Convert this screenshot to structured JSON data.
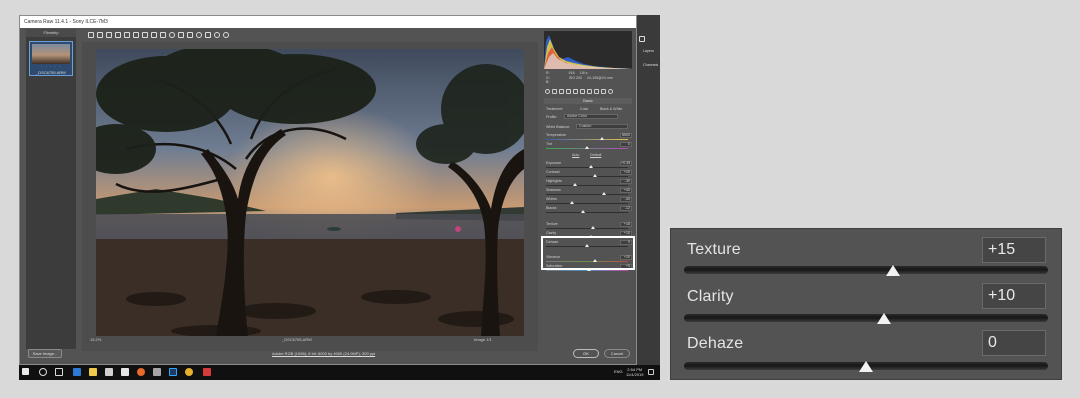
{
  "window": {
    "title": "Camera Raw 11.4.1 - Sony ILCE-7M3"
  },
  "filmstrip": {
    "title": "Filmstrip",
    "thumb_filename": "_DSC6755.ARW",
    "thumb_stars": "· · · · ·"
  },
  "camera_info": {
    "r_label": "R:",
    "r_value": "",
    "g_label": "G:",
    "g_value": "",
    "b_label": "B:",
    "b_value": "",
    "aperture": "f/16",
    "shutter": "1/8 s",
    "iso": "ISO 200",
    "lens": "24-105@24 mm"
  },
  "basic_panel": {
    "title": "Basic",
    "treatment_label": "Treatment:",
    "treatment_color": "Color",
    "treatment_bw": "Black & White",
    "profile_label": "Profile:",
    "profile_value": "Adobe Color",
    "wb_label": "White Balance:",
    "wb_value": "Custom",
    "temperature_label": "Temperature",
    "temperature_value": "5500",
    "tint_label": "Tint",
    "tint_value": "0",
    "auto_label": "Auto",
    "default_label": "Default",
    "exposure_label": "Exposure",
    "exposure_value": "+0.35",
    "contrast_label": "Contrast",
    "contrast_value": "+20",
    "highlights_label": "Highlights",
    "highlights_value": "-30",
    "shadows_label": "Shadows",
    "shadows_value": "+40",
    "whites_label": "Whites",
    "whites_value": "-40",
    "blacks_label": "Blacks",
    "blacks_value": "-12",
    "texture_label": "Texture",
    "texture_value": "+15",
    "clarity_label": "Clarity",
    "clarity_value": "+10",
    "dehaze_label": "Dehaze",
    "dehaze_value": "0",
    "vibrance_label": "Vibrance",
    "vibrance_value": "+20",
    "saturation_label": "Saturation",
    "saturation_value": "+5"
  },
  "statusbar": {
    "zoom": "15.2%",
    "filename": "_DSC6755.ARW",
    "image_count": "Image 1/1"
  },
  "footer": {
    "save_button": "Save Image...",
    "workflow_link": "Adobe RGB (1998); 8 bit; 6000 by 4000 (24.0MP); 300 ppi",
    "ok_button": "OK",
    "cancel_button": "Cancel"
  },
  "taskbar": {
    "lang": "ENG",
    "time": "2:54 PM",
    "date": "11/4/2019"
  },
  "ps_side": {
    "label1": "Layers",
    "label2": "Channels"
  },
  "inset": {
    "texture_label": "Texture",
    "texture_value": "+15",
    "texture_level": 0.575,
    "clarity_label": "Clarity",
    "clarity_value": "+10",
    "clarity_level": 0.55,
    "dehaze_label": "Dehaze",
    "dehaze_value": "0",
    "dehaze_level": 0.5
  }
}
